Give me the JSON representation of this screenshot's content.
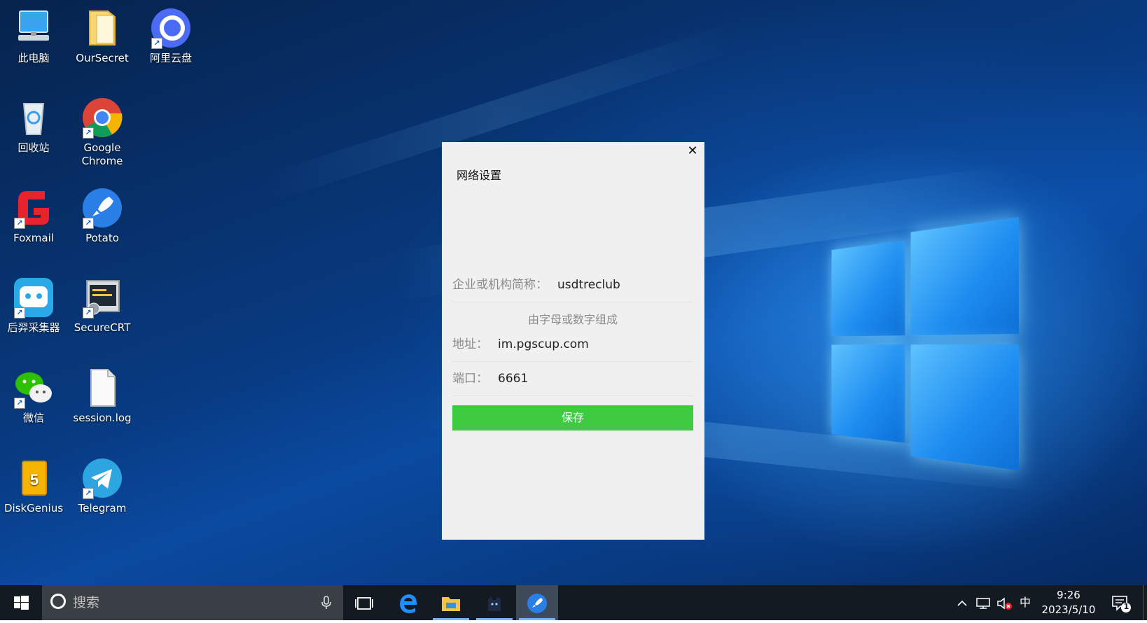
{
  "desktop": {
    "icons": [
      {
        "label": "此电脑",
        "icon": "computer-icon"
      },
      {
        "label": "OurSecret",
        "icon": "folder-icon"
      },
      {
        "label": "阿里云盘",
        "icon": "aliyun-drive-icon"
      },
      {
        "label": "回收站",
        "icon": "recycle-bin-icon"
      },
      {
        "label": "Google Chrome",
        "icon": "chrome-icon"
      },
      {
        "label": "Foxmail",
        "icon": "foxmail-icon"
      },
      {
        "label": "Potato",
        "icon": "potato-icon"
      },
      {
        "label": "后羿采集器",
        "icon": "houyi-collector-icon"
      },
      {
        "label": "SecureCRT",
        "icon": "securecrt-icon"
      },
      {
        "label": "微信",
        "icon": "wechat-icon"
      },
      {
        "label": "session.log",
        "icon": "file-icon"
      },
      {
        "label": "DiskGenius",
        "icon": "diskgenius-icon"
      },
      {
        "label": "Telegram",
        "icon": "telegram-icon"
      }
    ]
  },
  "dialog": {
    "title": "网络设置",
    "close_glyph": "✕",
    "org_label": "企业或机构简称：",
    "org_value": "usdtreclub",
    "hint": "由字母或数字组成",
    "address_label": "地址：",
    "address_value": "im.pgscup.com",
    "port_label": "端口：",
    "port_value": "6661",
    "save_label": "保存",
    "save_color": "#3ecb41"
  },
  "taskbar": {
    "search_placeholder": "搜索",
    "ime": "中",
    "time": "9:26",
    "date": "2023/5/10",
    "notification_count": "1"
  }
}
